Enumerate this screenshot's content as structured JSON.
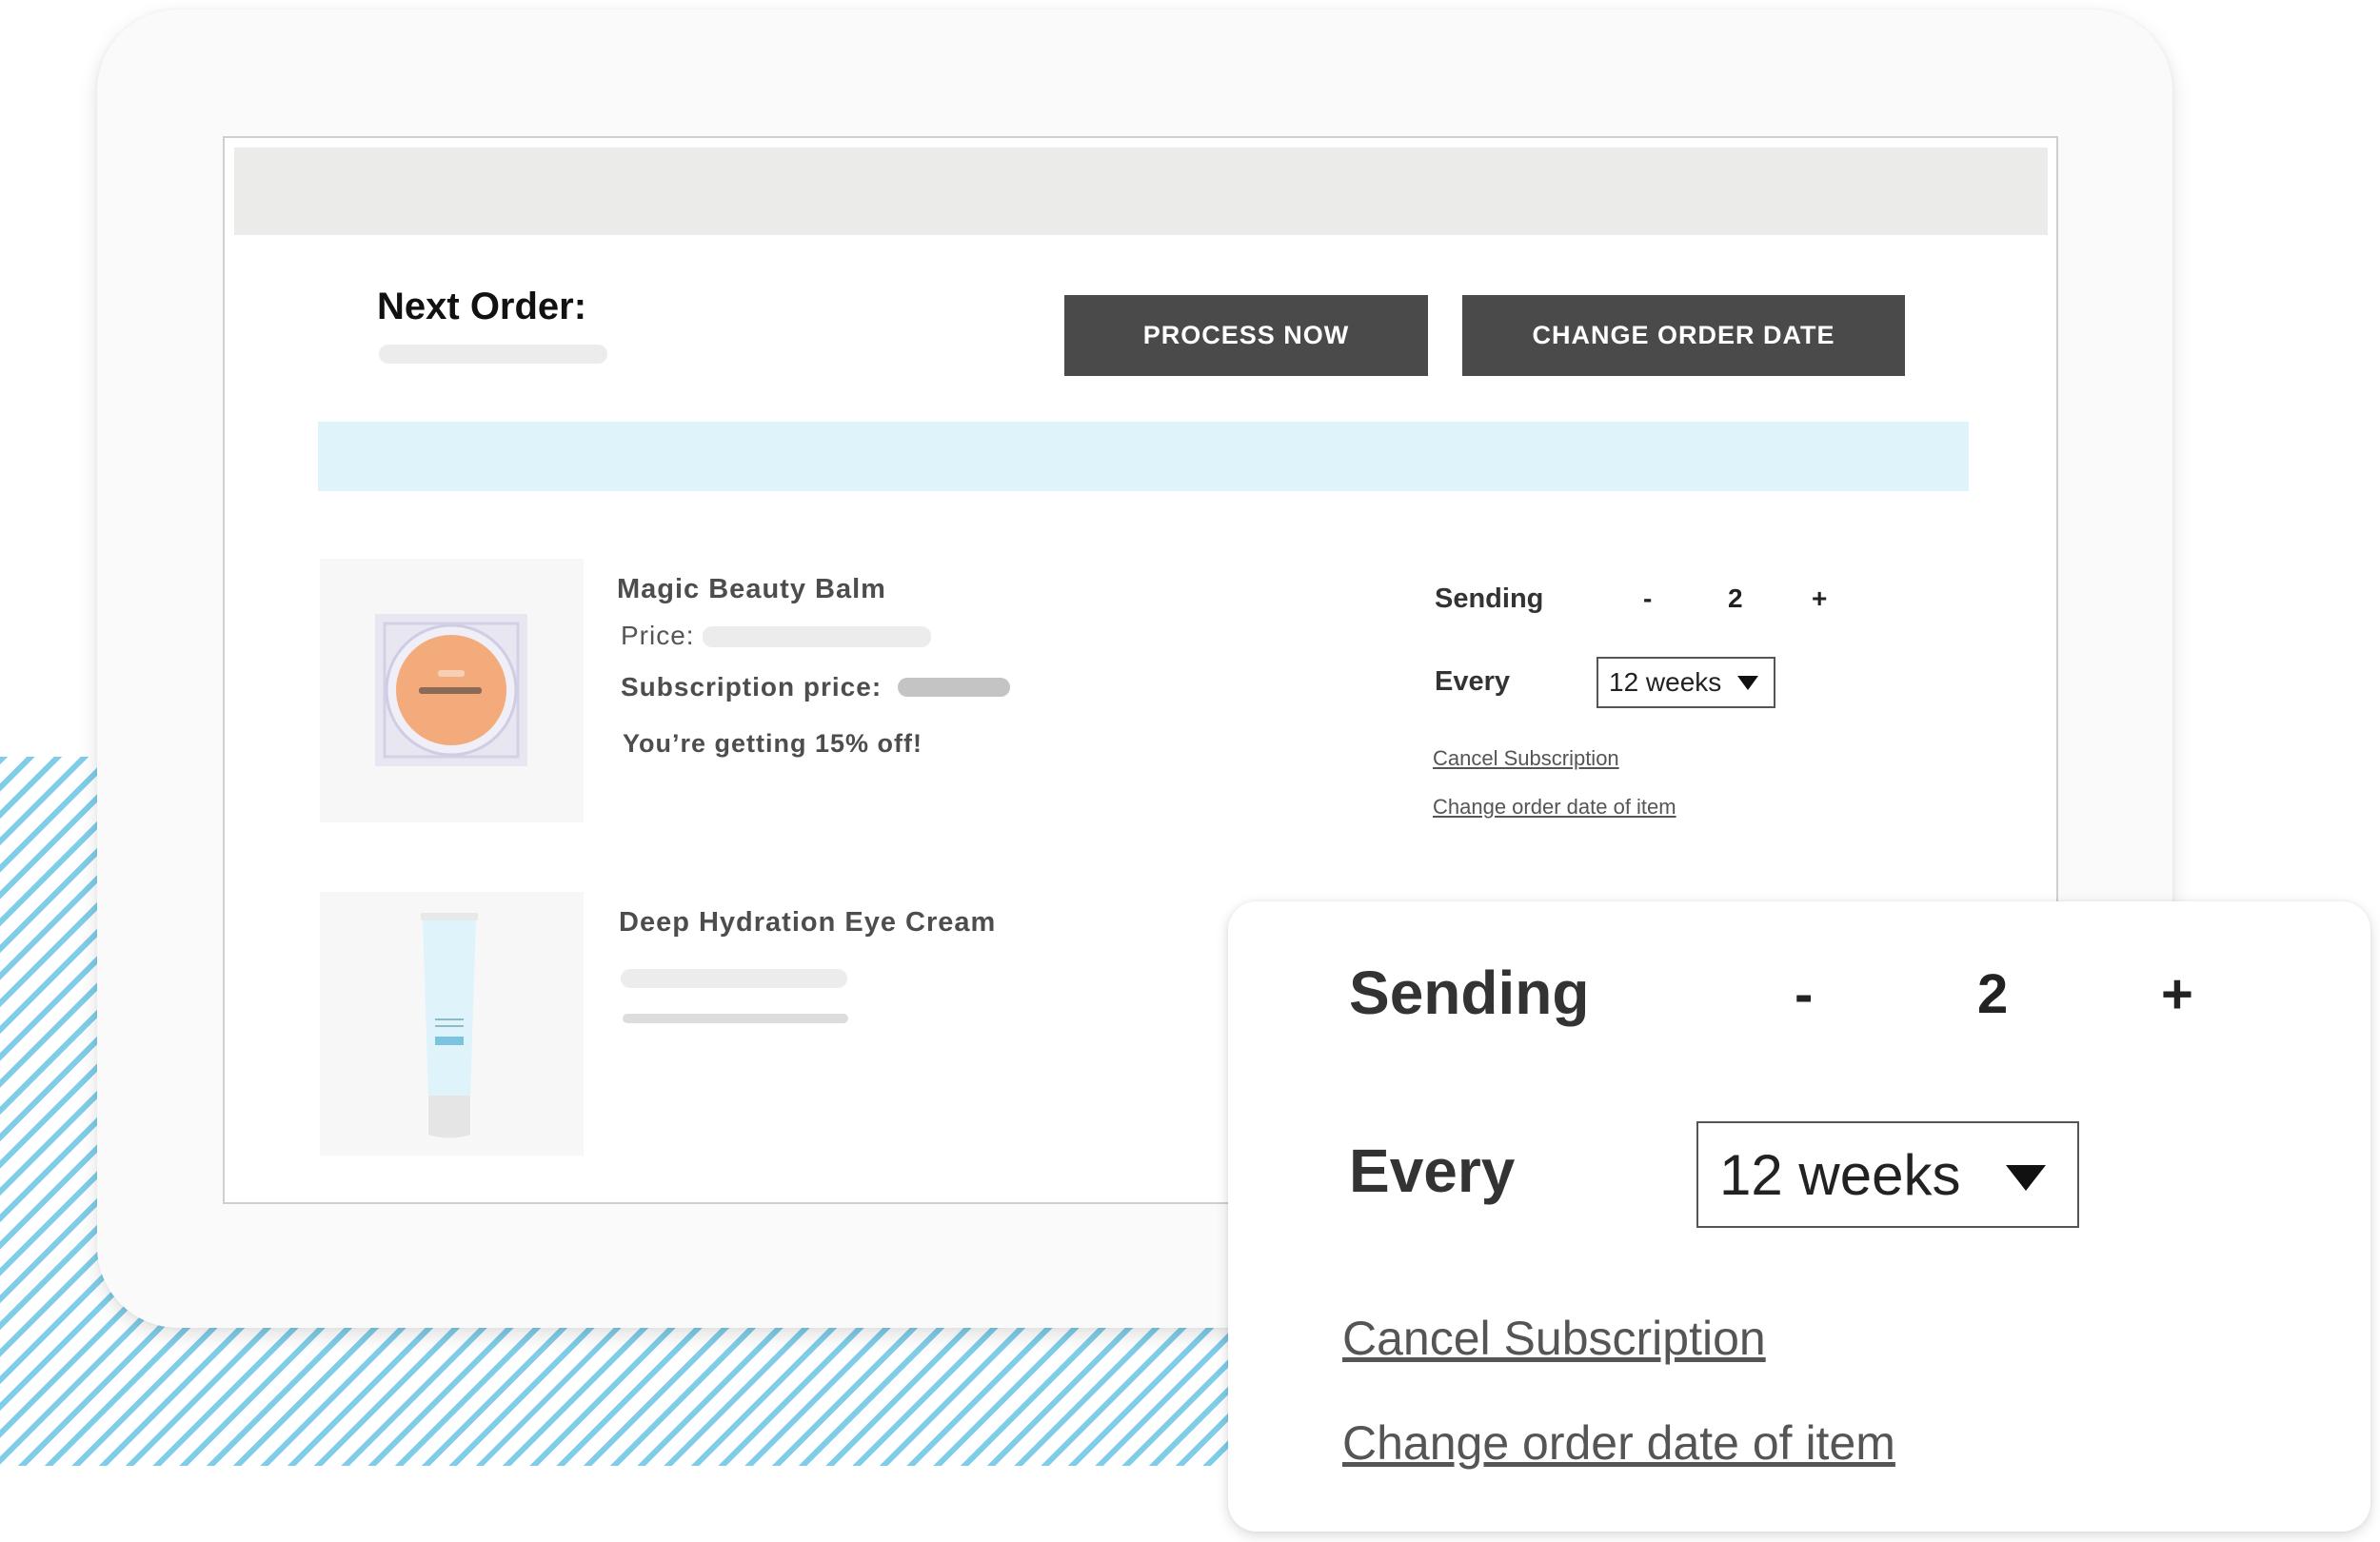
{
  "header": {
    "next_order_label": "Next Order:",
    "process_now_label": "PROCESS NOW",
    "change_order_date_label": "CHANGE ORDER DATE"
  },
  "products": [
    {
      "name": "Magic Beauty Balm",
      "price_label": "Price:",
      "subscription_price_label": "Subscription price:",
      "discount_text": "You’re getting 15% off!",
      "icon": "beauty-balm-compact"
    },
    {
      "name": "Deep Hydration Eye Cream",
      "icon": "eye-cream-tube"
    }
  ],
  "subscription_controls": {
    "sending_label": "Sending",
    "minus_label": "-",
    "quantity": "2",
    "plus_label": "+",
    "every_label": "Every",
    "frequency_value": "12 weeks",
    "cancel_link": "Cancel Subscription",
    "change_date_link": "Change order date of item"
  },
  "colors": {
    "button_bg": "#4a4a4a",
    "banner_bg": "#def3fa",
    "stripe": "#7fcde9",
    "balm_orange": "#f4ab7b",
    "tube_blue": "#def3fa"
  }
}
